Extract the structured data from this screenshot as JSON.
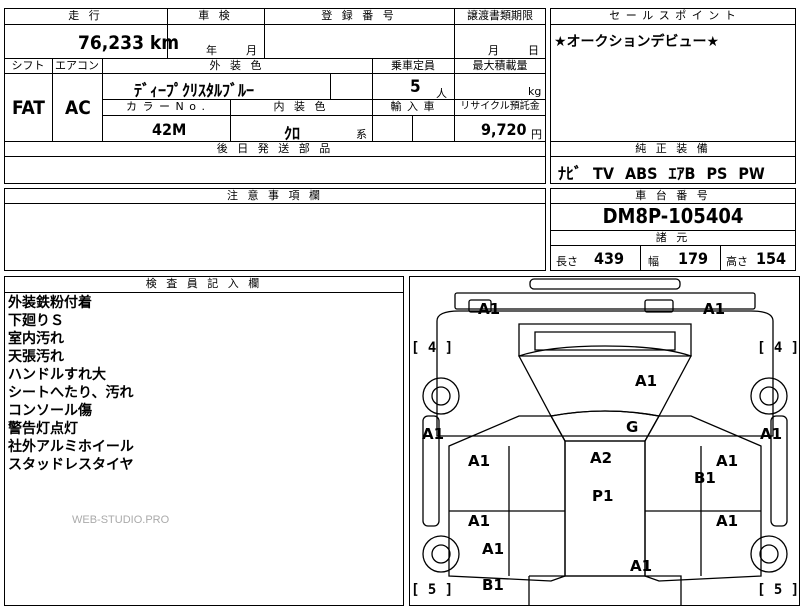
{
  "mileage": {
    "label": "走 行",
    "value": "76,233 km"
  },
  "inspection": {
    "label": "車 検",
    "year": "年",
    "month": "月"
  },
  "registration": {
    "label": "登 録 番 号"
  },
  "transfer": {
    "label": "譲渡書類期限",
    "month": "月",
    "day": "日"
  },
  "sales_point": {
    "label": "セ ー ル ス ポ イ ン ト",
    "text": "★オークションデビュー★"
  },
  "shift": {
    "label": "シフト",
    "value": "FAT"
  },
  "aircon": {
    "label": "エアコン",
    "value": "AC"
  },
  "exterior_color": {
    "label": "外 装 色",
    "value": "ﾃﾞｨｰﾌﾟｸﾘｽﾀﾙﾌﾞﾙｰ"
  },
  "capacity": {
    "label": "乗車定員",
    "value": "5",
    "unit": "人"
  },
  "max_load": {
    "label": "最大積載量",
    "unit": "kg"
  },
  "color_no": {
    "label": "カ ラ ー N o .",
    "value": "42M"
  },
  "interior_color": {
    "label": "内 装 色",
    "value": "ｸﾛ",
    "suffix": "系"
  },
  "import_car": {
    "label": "輸 入 車"
  },
  "recycle": {
    "label": "リサイクル預託金",
    "value": "9,720",
    "unit": "円"
  },
  "later_parts": {
    "label": "後 日 発 送 部 品"
  },
  "equipment": {
    "label": "純 正 装 備",
    "text": "ﾅﾋﾞ TV ABS ｴｱB PS PW"
  },
  "caution": {
    "label": "注 意 事 項 欄"
  },
  "chassis": {
    "label": "車 台 番 号",
    "value": "DM8P-105404"
  },
  "specs": {
    "label": "諸 元",
    "length_label": "長さ",
    "length": "439",
    "width_label": "幅",
    "width": "179",
    "height_label": "高さ",
    "height": "154"
  },
  "inspector": {
    "label": "検 査 員 記 入 欄",
    "notes": [
      "外装鉄粉付着",
      "下廻りＳ",
      "室内汚れ",
      "天張汚れ",
      "ハンドルすれ大",
      "シートへたり、汚れ",
      "コンソール傷",
      "警告灯点灯",
      "社外アルミホイール",
      "スタッドレスタイヤ"
    ]
  },
  "watermark": "WEB-STUDIO.PRO",
  "diagram": {
    "marks": [
      "A1",
      "A1",
      "A1",
      "A1",
      "A1",
      "G",
      "A1",
      "A2",
      "A1",
      "B1",
      "P1",
      "A1",
      "A1",
      "A1",
      "A1",
      "B1",
      "A1"
    ],
    "tire_labels": [
      "[ 4 ]",
      "[ 4 ]",
      "[ 5 ]",
      "[ 5 ]"
    ]
  }
}
